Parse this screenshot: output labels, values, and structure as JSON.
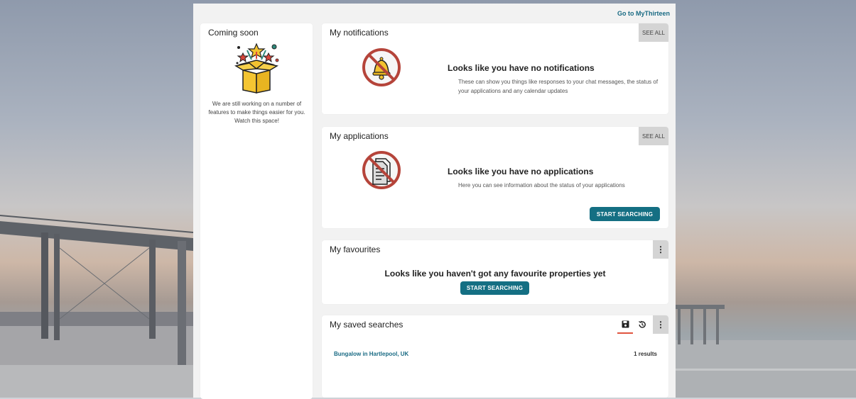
{
  "header": {
    "goto_link": "Go to MyThirteen"
  },
  "coming_soon": {
    "title": "Coming soon",
    "text": "We are still working on a number of features to make things easier for you. Watch this space!"
  },
  "notifications": {
    "title": "My notifications",
    "see_all": "SEE ALL",
    "empty_heading": "Looks like you have no notifications",
    "empty_text": "These can show you things like responses to your chat messages, the status of your applications and any calendar updates",
    "icon": "no-bell-icon"
  },
  "applications": {
    "title": "My applications",
    "see_all": "SEE ALL",
    "empty_heading": "Looks like you have no applications",
    "empty_text": "Here you can see information about the status of your applications",
    "button": "START SEARCHING",
    "icon": "no-document-icon"
  },
  "favourites": {
    "title": "My favourites",
    "empty_heading": "Looks like you haven't got any favourite properties yet",
    "button": "START SEARCHING"
  },
  "saved_searches": {
    "title": "My saved searches",
    "items": [
      {
        "name": "Bungalow in Hartlepool, UK",
        "count": "1 results"
      }
    ]
  },
  "colors": {
    "accent": "#146f83",
    "link": "#1a6b84",
    "forbidden": "#b5443a",
    "tab_underline": "#e0543f"
  }
}
